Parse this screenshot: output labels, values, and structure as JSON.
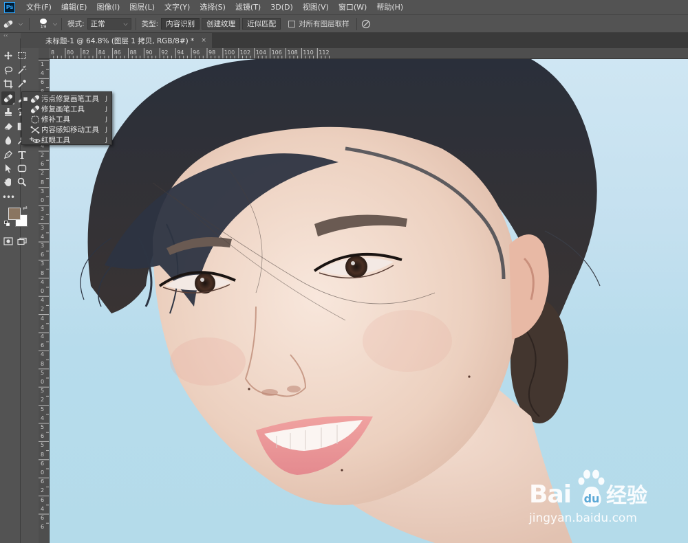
{
  "app": {
    "logo_text": "Ps"
  },
  "menu": {
    "items": [
      "文件(F)",
      "编辑(E)",
      "图像(I)",
      "图层(L)",
      "文字(Y)",
      "选择(S)",
      "滤镜(T)",
      "3D(D)",
      "视图(V)",
      "窗口(W)",
      "帮助(H)"
    ]
  },
  "options": {
    "tool_icon": "spot-healing-brush-icon",
    "brush_size": "19",
    "mode_label": "模式:",
    "mode_value": "正常",
    "type_label": "类型:",
    "type_buttons": [
      "内容识别",
      "创建纹理",
      "近似匹配"
    ],
    "type_selected": "内容识别",
    "sample_all_layers_label": "对所有图层取样",
    "sample_all_layers_checked": false,
    "pressure_icon": "pressure-size-icon"
  },
  "panel": {
    "collapse_glyph": "‹‹"
  },
  "document": {
    "tab_title": "未标题-1 @ 64.8% (图层 1 拷贝, RGB/8#) *",
    "close_glyph": "×",
    "zoom": "64.8%"
  },
  "rulers": {
    "horizontal": [
      "8",
      "80",
      "82",
      "84",
      "86",
      "88",
      "90",
      "92",
      "94",
      "96",
      "98",
      "100",
      "102",
      "104",
      "106",
      "108",
      "110",
      "112"
    ],
    "vertical": [
      "1",
      "4",
      "6",
      "8",
      "2",
      "0",
      "2",
      "2",
      "2",
      "4",
      "2",
      "6",
      "2",
      "8",
      "3",
      "0",
      "3",
      "2",
      "3",
      "4",
      "3",
      "6",
      "3",
      "8",
      "4",
      "0",
      "4",
      "2",
      "4",
      "4",
      "4",
      "6",
      "4",
      "8",
      "5",
      "0",
      "5",
      "2",
      "5",
      "4",
      "5",
      "6",
      "5",
      "8",
      "6",
      "0",
      "6",
      "2",
      "6",
      "4",
      "6",
      "6"
    ]
  },
  "toolbar": {
    "tools": [
      "move-icon",
      "marquee-icon",
      "lasso-icon",
      "magic-wand-icon",
      "crop-icon",
      "eyedropper-icon",
      "healing-brush-icon",
      "brush-icon",
      "stamp-icon",
      "history-brush-icon",
      "eraser-icon",
      "gradient-icon",
      "blur-icon",
      "dodge-icon",
      "pen-icon",
      "type-icon",
      "path-select-icon",
      "shape-icon",
      "hand-icon",
      "zoom-icon",
      "more-tools-icon"
    ],
    "foreground_color": "#8a7561",
    "background_color": "#ffffff"
  },
  "flyout": {
    "items": [
      {
        "label": "污点修复画笔工具",
        "key": "J",
        "icon": "spot-healing-brush-icon",
        "selected": true
      },
      {
        "label": "修复画笔工具",
        "key": "J",
        "icon": "healing-brush-icon",
        "selected": false
      },
      {
        "label": "修补工具",
        "key": "J",
        "icon": "patch-icon",
        "selected": false
      },
      {
        "label": "内容感知移动工具",
        "key": "J",
        "icon": "content-aware-move-icon",
        "selected": false
      },
      {
        "label": "红眼工具",
        "key": "J",
        "icon": "red-eye-icon",
        "selected": false
      }
    ]
  },
  "watermark": {
    "brand_text": "Bai",
    "brand_suffix": "经验",
    "url": "jingyan.baidu.com"
  }
}
